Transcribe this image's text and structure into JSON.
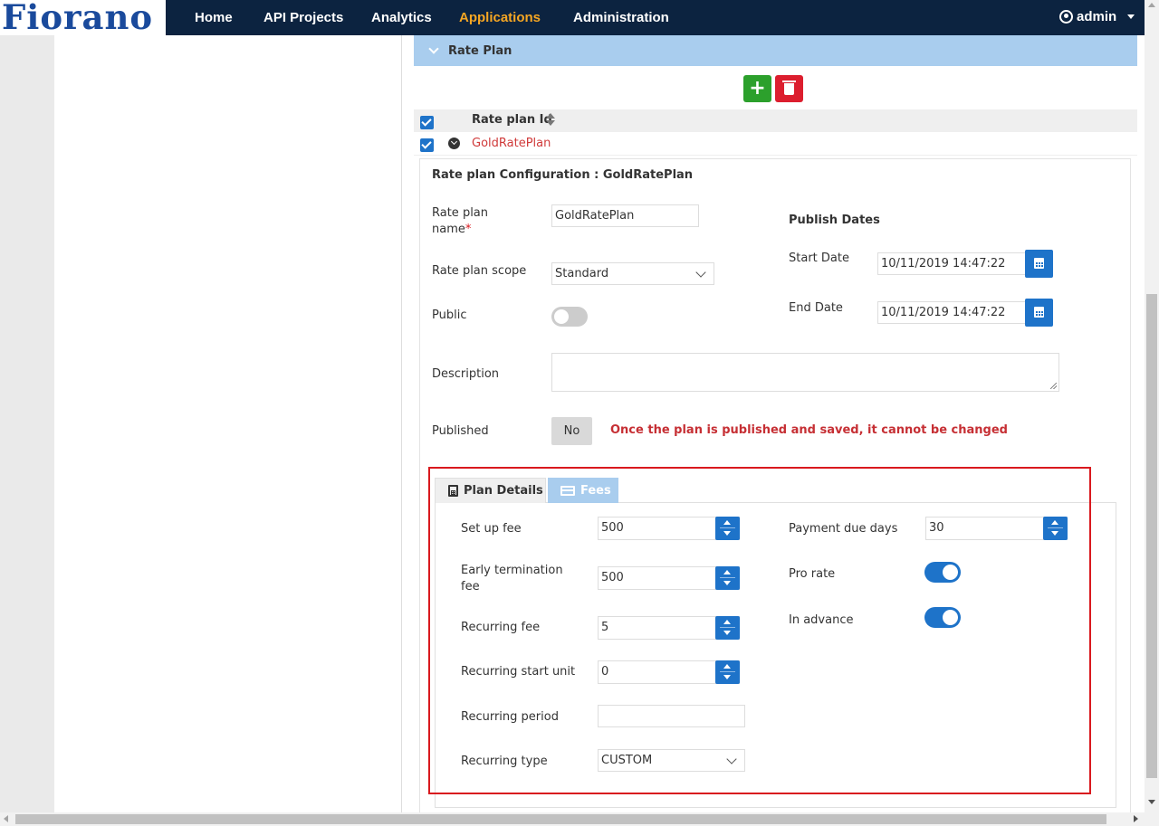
{
  "brand": {
    "logo_text": "Fiorano"
  },
  "nav": {
    "items": [
      {
        "label": "Home"
      },
      {
        "label": "API Projects"
      },
      {
        "label": "Analytics"
      },
      {
        "label": "Applications"
      },
      {
        "label": "Administration"
      }
    ],
    "active": "Applications",
    "user": "admin"
  },
  "section": {
    "title": "Rate Plan"
  },
  "table": {
    "header": "Rate plan Id",
    "rows": [
      {
        "id": "GoldRatePlan",
        "checked": true
      }
    ],
    "header_checked": true
  },
  "config": {
    "title": "Rate plan Configuration : GoldRatePlan",
    "name_label_1": "Rate plan",
    "name_label_2": "name",
    "required_mark": "*",
    "name_value": "GoldRatePlan",
    "scope_label": "Rate plan scope",
    "scope_value": "Standard",
    "public_label": "Public",
    "public_on": false,
    "description_label": "Description",
    "description_value": "",
    "published_label": "Published",
    "published_value": "No",
    "warning": "Once the plan is published and saved, it cannot be changed",
    "publish_dates_title": "Publish Dates",
    "start_label": "Start Date",
    "start_value": "10/11/2019 14:47:22",
    "end_label": "End Date",
    "end_value": "10/11/2019 14:47:22"
  },
  "tabs": [
    {
      "label": "Plan Details",
      "icon": "calculator-icon",
      "active": true
    },
    {
      "label": "Fees",
      "icon": "credit-card-icon",
      "active": false
    }
  ],
  "plan_details": {
    "setup_fee_label": "Set up fee",
    "setup_fee_value": "500",
    "early_term_label_1": "Early termination",
    "early_term_label_2": "fee",
    "early_term_value": "500",
    "recurring_fee_label": "Recurring fee",
    "recurring_fee_value": "5",
    "recurring_start_label": "Recurring start unit",
    "recurring_start_value": "0",
    "recurring_period_label": "Recurring period",
    "recurring_period_value": "",
    "recurring_type_label": "Recurring type",
    "recurring_type_value": "CUSTOM",
    "payment_due_label": "Payment due days",
    "payment_due_value": "30",
    "pro_rate_label": "Pro rate",
    "pro_rate_on": true,
    "in_advance_label": "In advance",
    "in_advance_on": true
  },
  "colors": {
    "navbar": "#0c2340",
    "nav_active": "#f5a623",
    "section_header": "#a9cdee",
    "primary": "#1e73c9",
    "add_button": "#2ca02c",
    "delete_button": "#dc1e2e",
    "link": "#d03a3a",
    "warning": "#c62f34",
    "highlight_box": "#d9191e"
  }
}
